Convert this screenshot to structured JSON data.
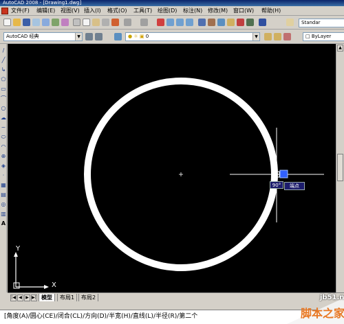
{
  "window": {
    "title": "AutoCAD 2008 - [Drawing1.dwg]"
  },
  "menu": [
    "文件(F)",
    "编辑(E)",
    "视图(V)",
    "插入(I)",
    "格式(O)",
    "工具(T)",
    "绘图(D)",
    "标注(N)",
    "修改(M)",
    "窗口(W)",
    "帮助(H)"
  ],
  "toolbar": {
    "workspace": "AutoCAD 经典",
    "layer": "0",
    "linetype": "ByLayer",
    "style_label": "Standar"
  },
  "canvas": {
    "background": "#000000",
    "circle_color": "#ffffff",
    "ucs_y": "Y",
    "ucs_x": "X",
    "tooltip_angle": "90°",
    "tooltip_snap": "端点"
  },
  "tabs": [
    "模型",
    "布局1",
    "布局2"
  ],
  "command_line": "[角度(A)/圆心(CE)/闭合(CL)/方向(D)/半宽(H)/直线(L)/半径(R)/第二个",
  "watermark": {
    "url": "jb51.net",
    "brand": "脚本之家"
  }
}
